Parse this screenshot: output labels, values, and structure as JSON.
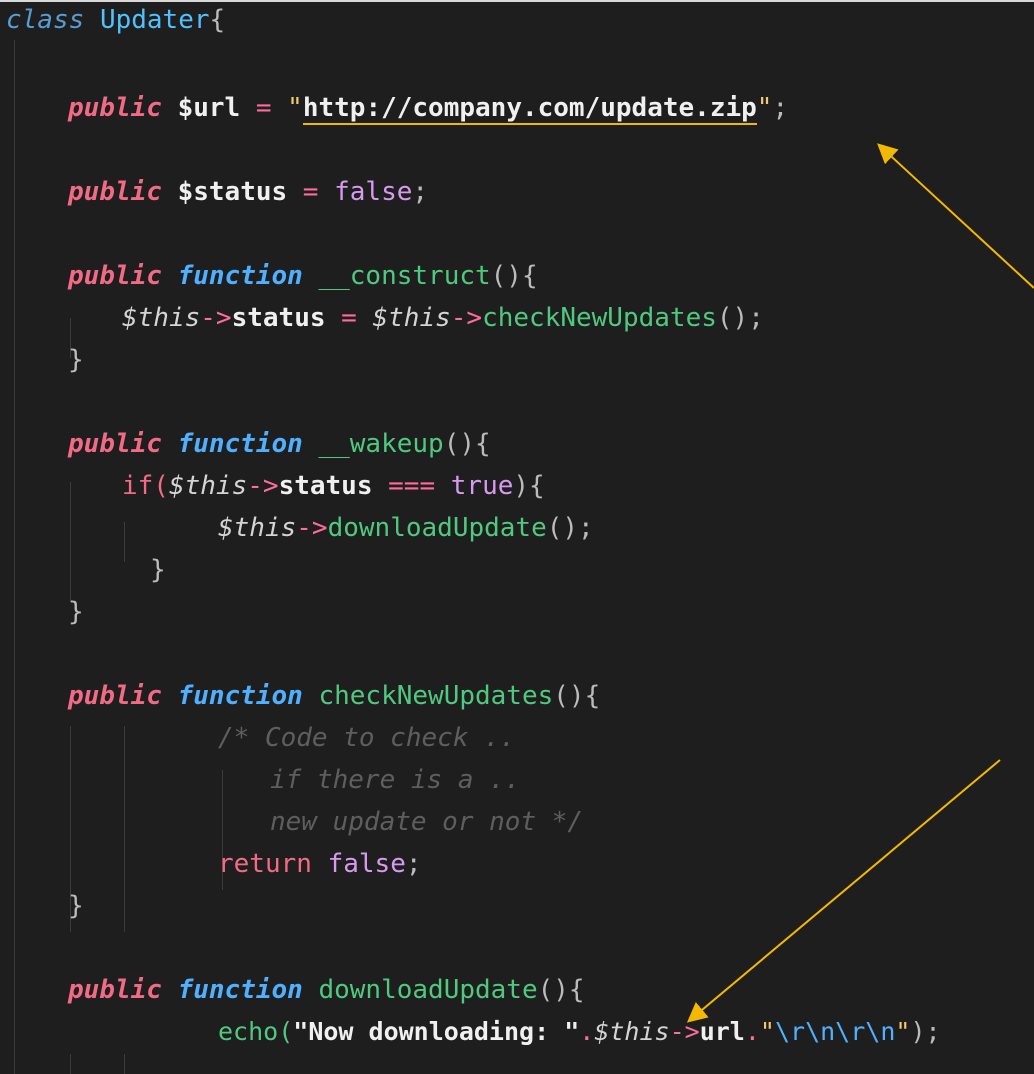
{
  "code": {
    "line1": {
      "kw": "class",
      "name": "Updater",
      "brace": "{"
    },
    "line2": {
      "kw": "public",
      "var": "$url",
      "eq": " = ",
      "q1": "\"",
      "str": "http://company.com/update.zip",
      "q2": "\"",
      "semi": ";"
    },
    "line3": {
      "kw": "public",
      "var": "$status",
      "eq": " = ",
      "val": "false",
      "semi": ";"
    },
    "line4": {
      "kw": "public",
      "fn": "function",
      "name": "__construct",
      "paren": "(){"
    },
    "line5": {
      "this1": "$this",
      "arrow1": "->",
      "prop": "status",
      "eq": " = ",
      "this2": "$this",
      "arrow2": "->",
      "method": "checkNewUpdates",
      "paren": "();"
    },
    "line6": {
      "brace": "}"
    },
    "line7": {
      "kw": "public",
      "fn": "function",
      "name": "__wakeup",
      "paren": "(){"
    },
    "line8": {
      "if": "if(",
      "this": "$this",
      "arrow": "->",
      "prop": "status",
      "op": " === ",
      "val": "true",
      "paren": "){"
    },
    "line9": {
      "this": "$this",
      "arrow": "->",
      "method": "downloadUpdate",
      "paren": "();"
    },
    "line10": {
      "brace": "}"
    },
    "line11": {
      "brace": "}"
    },
    "line12": {
      "kw": "public",
      "fn": "function",
      "name": "checkNewUpdates",
      "paren": "(){"
    },
    "line13": {
      "cmt": "/* Code to check .."
    },
    "line14": {
      "cmt": "if there is a .."
    },
    "line15": {
      "cmt": "new update or not */"
    },
    "line16": {
      "ret": "return",
      "val": "false",
      "semi": ";"
    },
    "line17": {
      "brace": "}"
    },
    "line18": {
      "kw": "public",
      "fn": "function",
      "name": "downloadUpdate",
      "paren": "(){"
    },
    "line19": {
      "echo": "echo(",
      "str1": "\"Now downloading: \"",
      "dot1": ".",
      "this": "$this",
      "arrow": "->",
      "prop": "url",
      "dot2": ".",
      "q1": "\"",
      "esc": "\\r\\n\\r\\n",
      "q2": "\"",
      "end": ");"
    }
  },
  "colors": {
    "background": "#1e1e1e",
    "annotation_arrow": "#f5b800"
  },
  "annotations": [
    "arrow-to-url-string",
    "arrow-to-downloadUpdate-function"
  ]
}
